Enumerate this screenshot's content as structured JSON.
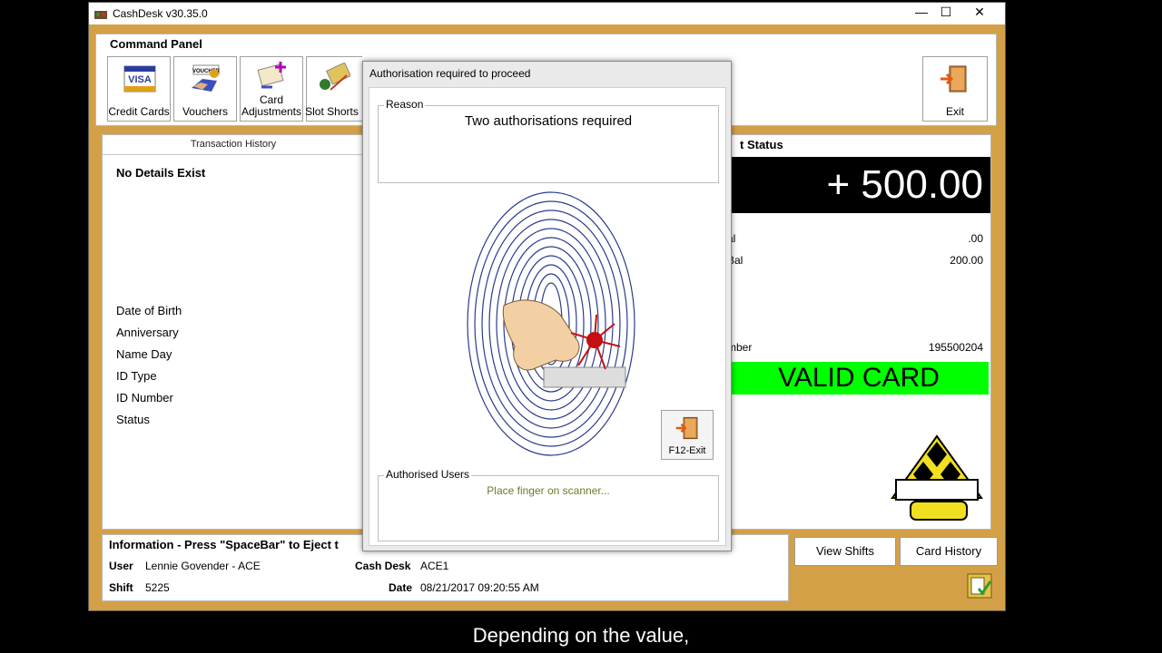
{
  "window": {
    "title": "CashDesk v30.35.0",
    "controls": [
      "—",
      "☐",
      "✕"
    ]
  },
  "command_panel": {
    "title": "Command Panel",
    "buttons": [
      {
        "label": "Credit Cards",
        "icon": "visa-card-icon",
        "icon_text": "VISA"
      },
      {
        "label": "Vouchers",
        "icon": "voucher-icon",
        "icon_text": "VOUCHER"
      },
      {
        "label": "Card Adjustments",
        "label_line1": "Card",
        "label_line2": "Adjustments",
        "icon": "card-adjust-icon"
      },
      {
        "label": "Slot Shorts",
        "icon": "slot-shorts-icon"
      },
      {
        "label": "Exit",
        "icon": "exit-door-icon"
      }
    ]
  },
  "history": {
    "tab": "Transaction History",
    "empty": "No Details Exist",
    "fields": [
      "Date of Birth",
      "Anniversary",
      "Name Day",
      "ID Type",
      "ID Number",
      "Status"
    ]
  },
  "status": {
    "title_partial": "t Status",
    "amount": "+ 500.00",
    "rows": [
      {
        "label": "al",
        "value": ".00"
      },
      {
        "label": "Bal",
        "value": "200.00"
      },
      {
        "label": "mber",
        "value": "195500204"
      }
    ],
    "card_state": "VALID CARD",
    "card_state_color": "#00ff00"
  },
  "info": {
    "title": "Information - Press \"SpaceBar\" to Eject t",
    "user_label": "User",
    "user": "Lennie Govender - ACE",
    "shift_label": "Shift",
    "shift": "5225",
    "cashdesk_label": "Cash Desk",
    "cashdesk": "ACE1",
    "date_label": "Date",
    "date": "08/21/2017 09:20:55 AM"
  },
  "actions": {
    "view_shifts": "View Shifts",
    "card_history": "Card History"
  },
  "dialog": {
    "title": "Authorisation required to proceed",
    "reason_label": "Reason",
    "reason": "Two authorisations required",
    "exit_label": "F12-Exit",
    "users_label": "Authorised Users",
    "prompt": "Place finger on scanner..."
  },
  "subtitle": "Depending on the value,",
  "colors": {
    "window_bg": "#d4a047",
    "amount_bg": "#000000",
    "valid_green": "#00ff00",
    "prompt_text": "#6d7a2a"
  }
}
